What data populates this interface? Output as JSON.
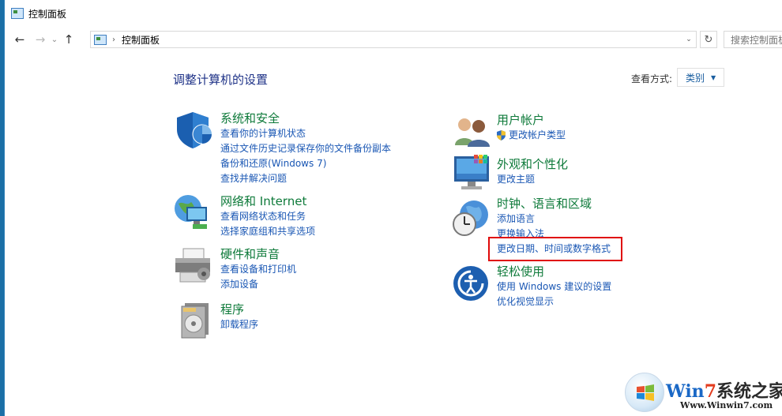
{
  "window": {
    "title": "控制面板",
    "address": "控制面板",
    "search_placeholder": "搜索控制面板"
  },
  "nav": {
    "back": "←",
    "forward": "→",
    "recent": "⌄",
    "up": "↑",
    "breadcrumb_sep": "›",
    "dropdown": "⌄",
    "refresh": "↻"
  },
  "page": {
    "heading": "调整计算机的设置",
    "view_by_label": "查看方式:",
    "view_by_value": "类别",
    "view_by_caret": "▼"
  },
  "categories": {
    "system_security": {
      "title": "系统和安全",
      "links": [
        "查看你的计算机状态",
        "通过文件历史记录保存你的文件备份副本",
        "备份和还原(Windows 7)",
        "查找并解决问题"
      ]
    },
    "network": {
      "title": "网络和 Internet",
      "links": [
        "查看网络状态和任务",
        "选择家庭组和共享选项"
      ]
    },
    "hardware": {
      "title": "硬件和声音",
      "links": [
        "查看设备和打印机",
        "添加设备"
      ]
    },
    "programs": {
      "title": "程序",
      "links": [
        "卸载程序"
      ]
    },
    "user_accounts": {
      "title": "用户帐户",
      "links": [
        "更改帐户类型"
      ]
    },
    "appearance": {
      "title": "外观和个性化",
      "links": [
        "更改主题"
      ]
    },
    "clock_region": {
      "title": "时钟、语言和区域",
      "links": [
        "添加语言",
        "更换输入法",
        "更改日期、时间或数字格式"
      ]
    },
    "ease_of_access": {
      "title": "轻松使用",
      "links": [
        "使用 Windows 建议的设置",
        "优化视觉显示"
      ]
    }
  },
  "watermark": {
    "brand_part1": "Win",
    "brand_part2": "7",
    "brand_part3": "系统之家",
    "url": "Www.Winwin7.com"
  },
  "colors": {
    "category_title": "#0e7a3a",
    "link": "#1a57b4",
    "heading": "#1e3287",
    "highlight_border": "#e00a0a"
  }
}
